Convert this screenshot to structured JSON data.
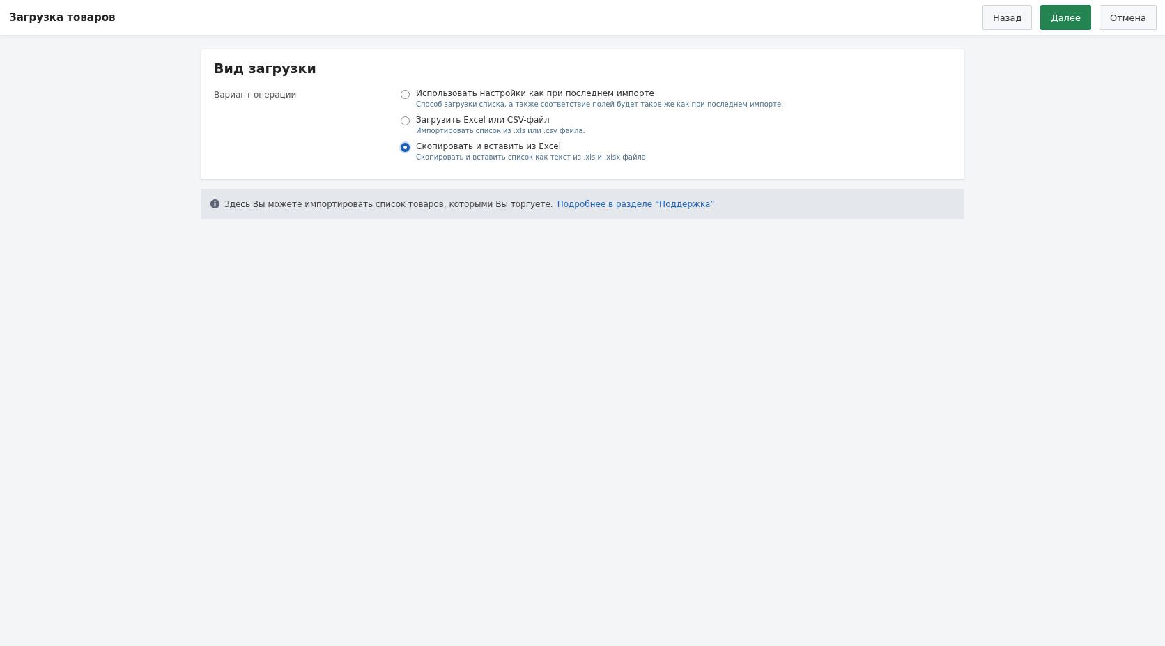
{
  "header": {
    "title": "Загрузка товаров",
    "buttons": [
      {
        "label": "Назад",
        "kind": "default"
      },
      {
        "label": "Далее",
        "kind": "primary"
      },
      {
        "label": "Отмена",
        "kind": "default"
      }
    ]
  },
  "card": {
    "title": "Вид загрузки",
    "field_label": "Вариант операции",
    "options": [
      {
        "label": "Использовать настройки как при последнем импорте",
        "hint": "Способ загрузки списка, а также соответствие полей будет такое же как при последнем импорте.",
        "selected": false
      },
      {
        "label": "Загрузить Excel или CSV-файл",
        "hint": "Импортировать список из .xls или .csv файла.",
        "selected": false
      },
      {
        "label": "Скопировать и вставить из Excel",
        "hint": "Скопировать и вставить список как текст из .xls и .xlsx файла",
        "selected": true
      }
    ]
  },
  "info": {
    "text": "Здесь Вы можете импортировать список товаров, которыми Вы торгуете.",
    "link": "Подробнее в разделе “Поддержка”"
  }
}
